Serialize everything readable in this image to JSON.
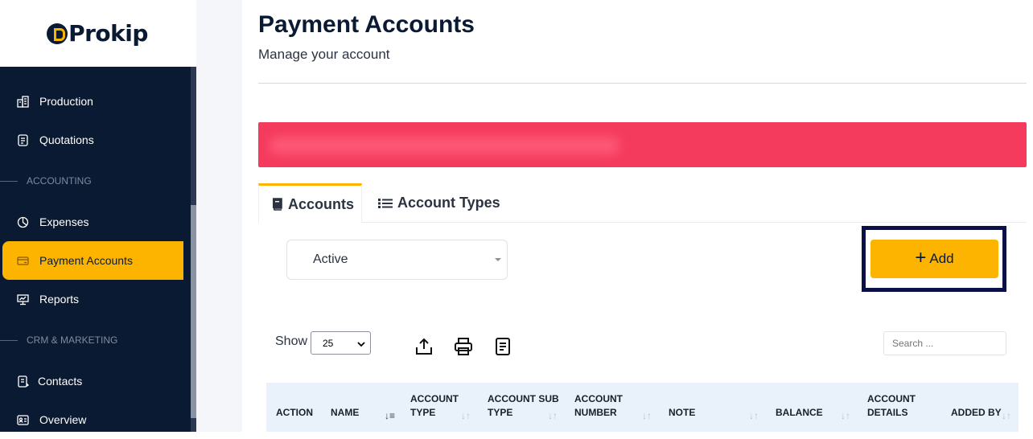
{
  "brand": {
    "name": "Prokip"
  },
  "sidebar": {
    "items": [
      {
        "label": "Production",
        "icon": "production-icon"
      },
      {
        "label": "Quotations",
        "icon": "quotations-icon"
      },
      {
        "label": "Expenses",
        "icon": "expenses-icon"
      },
      {
        "label": "Payment Accounts",
        "icon": "payment-accounts-icon",
        "active": true
      },
      {
        "label": "Reports",
        "icon": "reports-icon"
      },
      {
        "label": "Contacts",
        "icon": "contacts-icon"
      },
      {
        "label": "Overview",
        "icon": "overview-icon"
      }
    ],
    "sections": {
      "accounting": "ACCOUNTING",
      "crm": "CRM & MARKETING"
    }
  },
  "page": {
    "title": "Payment Accounts",
    "subtitle": "Manage your account"
  },
  "tabs": [
    {
      "label": "Accounts",
      "active": true
    },
    {
      "label": "Account Types"
    }
  ],
  "filter": {
    "status": "Active"
  },
  "actions": {
    "add_label": "Add"
  },
  "table_controls": {
    "show_label": "Show",
    "page_size": "25",
    "search_placeholder": "Search ..."
  },
  "table": {
    "columns": [
      "ACTION",
      "NAME",
      "ACCOUNT TYPE",
      "ACCOUNT SUB TYPE",
      "ACCOUNT NUMBER",
      "NOTE",
      "BALANCE",
      "ACCOUNT DETAILS",
      "ADDED BY"
    ]
  },
  "colors": {
    "sidebar_bg": "#0b1a33",
    "accent": "#fdb400",
    "alert": "#f43b5d",
    "header_bg": "#e9f1fb"
  }
}
